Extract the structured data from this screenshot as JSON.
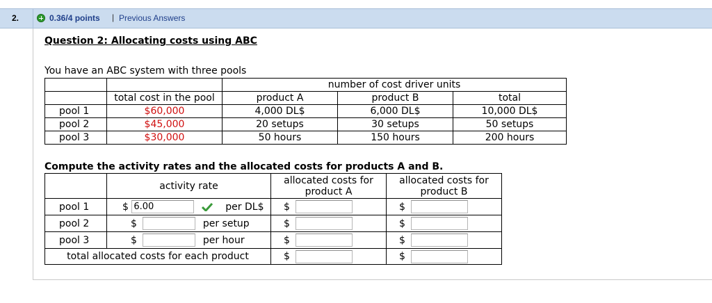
{
  "header": {
    "question_number": "2.",
    "points": "0.36/4 points",
    "separator": "|",
    "previous_answers": "Previous Answers"
  },
  "question": {
    "title": "Question 2: Allocating costs using ABC",
    "intro": "You have an ABC system with three pools",
    "instruction": "Compute the activity rates and the allocated costs for products A and B."
  },
  "pools_table": {
    "group_header": "number of cost driver units",
    "col_total_cost": "total cost in the pool",
    "col_product_a": "product A",
    "col_product_b": "product B",
    "col_total": "total",
    "rows": [
      {
        "pool": "pool 1",
        "cost": "$60,000",
        "a": "4,000 DL$",
        "b": "6,000 DL$",
        "total": "10,000 DL$"
      },
      {
        "pool": "pool 2",
        "cost": "$45,000",
        "a": "20 setups",
        "b": "30 setups",
        "total": "50 setups"
      },
      {
        "pool": "pool 3",
        "cost": "$30,000",
        "a": "50 hours",
        "b": "150 hours",
        "total": "200 hours"
      }
    ]
  },
  "answer_table": {
    "col_activity_rate": "activity rate",
    "col_alloc_a": "allocated costs for product A",
    "col_alloc_b": "allocated costs for product B",
    "currency": "$",
    "rows": [
      {
        "pool": "pool 1",
        "rate_value": "6.00",
        "unit": "per DL$",
        "correct": true
      },
      {
        "pool": "pool 2",
        "rate_value": "",
        "unit": "per setup"
      },
      {
        "pool": "pool 3",
        "rate_value": "",
        "unit": "per hour"
      }
    ],
    "total_label": "total allocated costs for each product"
  },
  "colors": {
    "header_bg": "#cbdcef",
    "link": "#1f3f8a",
    "cost_red": "#d01010",
    "correct_green": "#3a9a3a"
  }
}
